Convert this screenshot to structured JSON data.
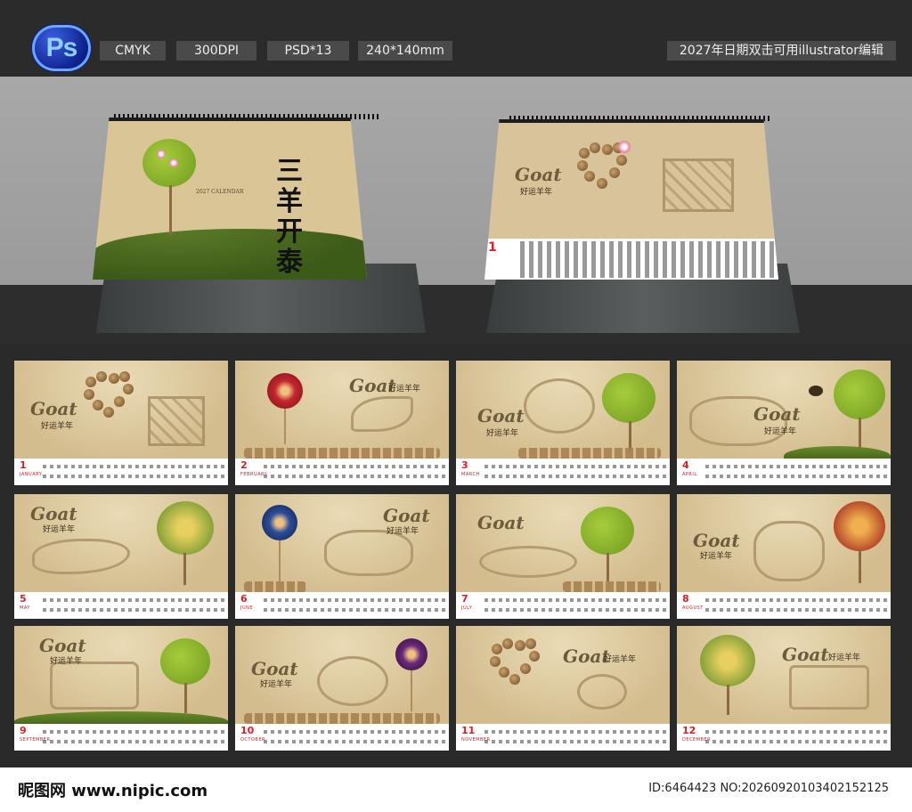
{
  "header": {
    "ps_badge": "Ps",
    "tags": [
      "CMYK",
      "300DPI",
      "PSD*13",
      "240*140mm"
    ],
    "note": "2027年日期双击可用illustrator编辑"
  },
  "cover": {
    "calendar_label": "2027 CALENDAR",
    "title": "三羊开泰"
  },
  "january_preview": {
    "logo": "Goat",
    "subtitle": "好运羊年",
    "month_number": "1"
  },
  "months": [
    {
      "num": "1",
      "name": "JANUARY"
    },
    {
      "num": "2",
      "name": "FEBRUARY"
    },
    {
      "num": "3",
      "name": "MARCH"
    },
    {
      "num": "4",
      "name": "APRIL"
    },
    {
      "num": "5",
      "name": "MAY"
    },
    {
      "num": "6",
      "name": "JUNE"
    },
    {
      "num": "7",
      "name": "JULY"
    },
    {
      "num": "8",
      "name": "AUGUST"
    },
    {
      "num": "9",
      "name": "SEPTEMBER"
    },
    {
      "num": "10",
      "name": "OCTOBER"
    },
    {
      "num": "11",
      "name": "NOVEMBER"
    },
    {
      "num": "12",
      "name": "DECEMBER"
    }
  ],
  "month_logo": "Goat",
  "month_subtitle": "好运羊年",
  "footer": {
    "site": "昵图网 www.nipic.com",
    "id": "ID:6464423 NO:20260920103402152125"
  },
  "colors": {
    "accent_red": "#d2232a",
    "kraft": "#d8c49a",
    "stage_gray": "#9b9b9b"
  }
}
